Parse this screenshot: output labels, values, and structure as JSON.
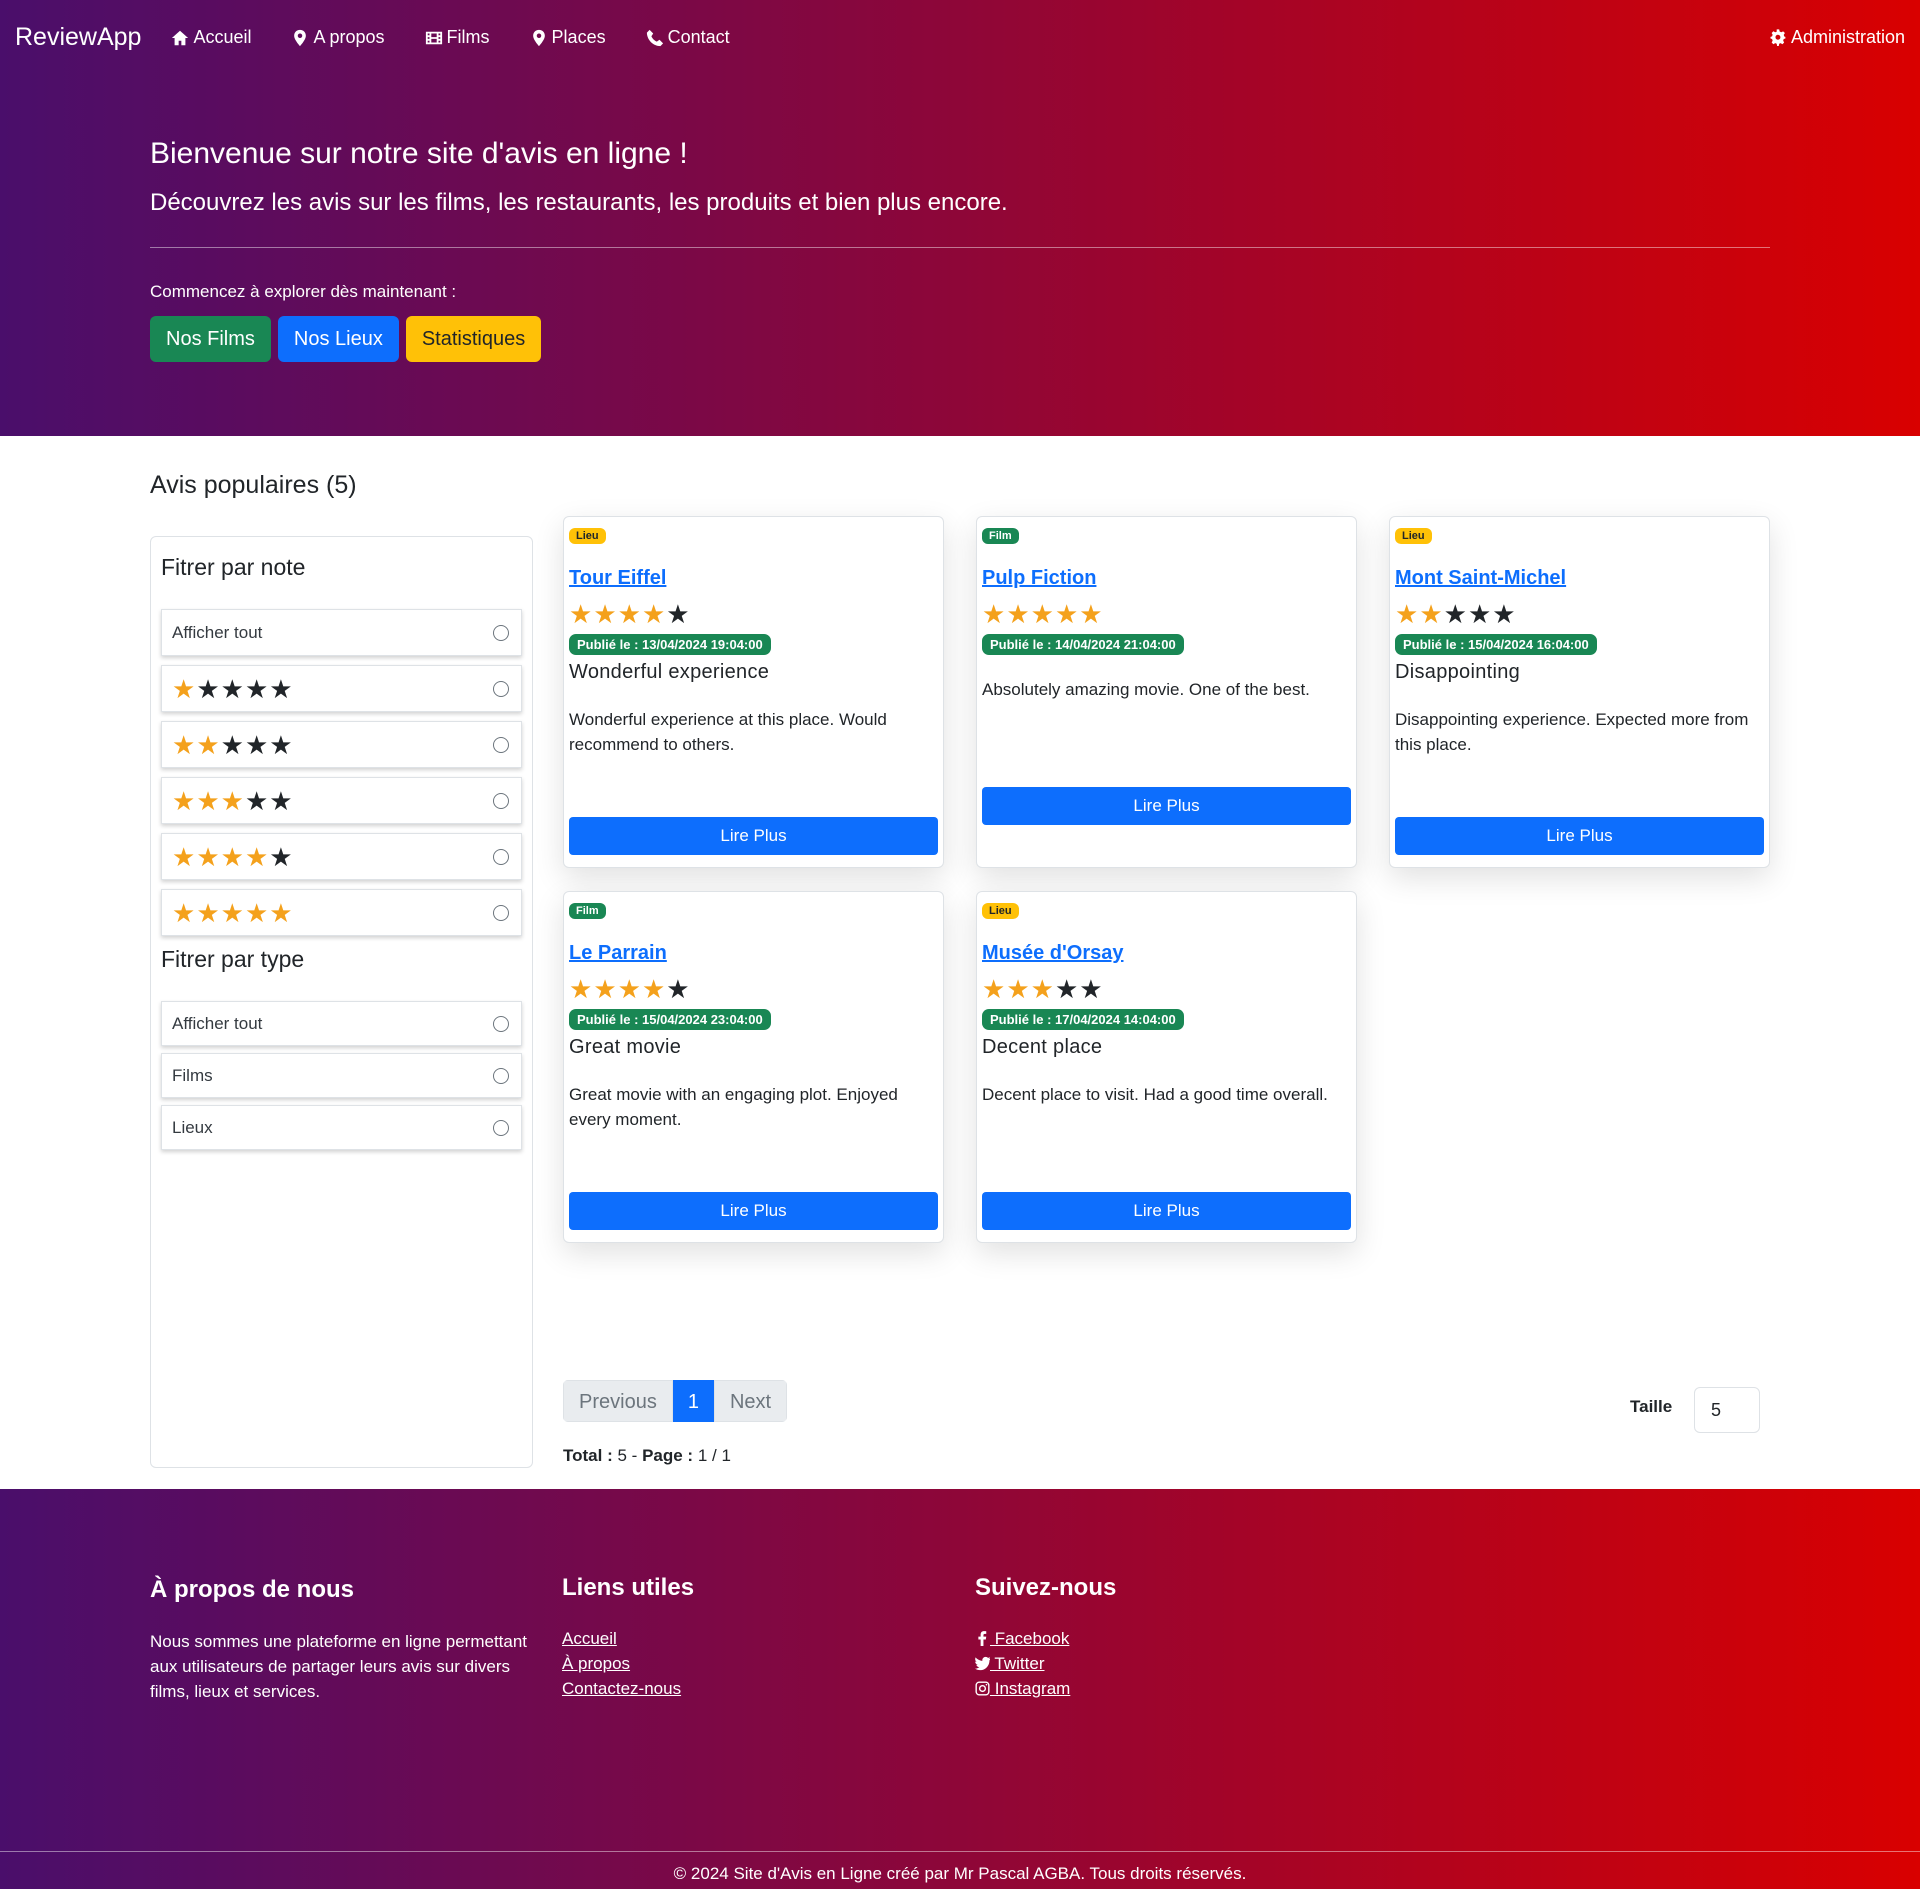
{
  "nav": {
    "brand": "ReviewApp",
    "items": [
      {
        "label": "Accueil",
        "icon": "home-icon"
      },
      {
        "label": "A propos",
        "icon": "map-marker-icon"
      },
      {
        "label": "Films",
        "icon": "film-icon"
      },
      {
        "label": "Places",
        "icon": "map-marker-icon"
      },
      {
        "label": "Contact",
        "icon": "phone-icon"
      }
    ],
    "admin": "Administration"
  },
  "hero": {
    "title": "Bienvenue sur notre site d'avis en ligne !",
    "lead": "Découvrez les avis sur les films, les restaurants, les produits et bien plus encore.",
    "cta": "Commencez à explorer dès maintenant :",
    "buttons": {
      "films": "Nos Films",
      "lieux": "Nos Lieux",
      "stats": "Statistiques"
    }
  },
  "reviews": {
    "heading": "Avis populaires (5)",
    "filters": {
      "note_title": "Fitrer par note",
      "show_all": "Afficher tout",
      "note_options": [
        1,
        2,
        3,
        4,
        5
      ],
      "type_title": "Fitrer par type",
      "type_show_all": "Afficher tout",
      "type_films": "Films",
      "type_lieux": "Lieux"
    },
    "pagination": {
      "previous": "Previous",
      "current": "1",
      "next": "Next",
      "total_label": "Total :",
      "total_value": "5",
      "separator": "-",
      "page_label": "Page :",
      "page_value": "1 / 1",
      "taille_label": "Taille",
      "taille_value": "5"
    },
    "read_more": "Lire Plus",
    "cards": [
      {
        "type": "Lieu",
        "title": "Tour Eiffel",
        "rating": 4,
        "date": "Publié le : 13/04/2024 19:04:00",
        "subtitle": "Wonderful experience",
        "text": "Wonderful experience at this place. Would recommend to others."
      },
      {
        "type": "Film",
        "title": "Pulp Fiction",
        "rating": 5,
        "date": "Publié le : 14/04/2024 21:04:00",
        "subtitle": "",
        "text": "Absolutely amazing movie. One of the best."
      },
      {
        "type": "Lieu",
        "title": "Mont Saint-Michel",
        "rating": 2,
        "date": "Publié le : 15/04/2024 16:04:00",
        "subtitle": "Disappointing",
        "text": "Disappointing experience. Expected more from this place."
      },
      {
        "type": "Film",
        "title": "Le Parrain",
        "rating": 4,
        "date": "Publié le : 15/04/2024 23:04:00",
        "subtitle": "Great movie",
        "text": "Great movie with an engaging plot. Enjoyed every moment."
      },
      {
        "type": "Lieu",
        "title": "Musée d'Orsay",
        "rating": 3,
        "date": "Publié le : 17/04/2024 14:04:00",
        "subtitle": "Decent place",
        "text": "Decent place to visit. Had a good time overall."
      }
    ]
  },
  "footer": {
    "about_title": "À propos de nous",
    "about_text": "Nous sommes une plateforme en ligne permettant aux utilisateurs de partager leurs avis sur divers films, lieux et services.",
    "links_title": "Liens utiles",
    "links": [
      "Accueil",
      "À propos",
      "Contactez-nous"
    ],
    "social_title": "Suivez-nous",
    "social": [
      {
        "label": " Facebook",
        "icon": "facebook-icon"
      },
      {
        "label": " Twitter",
        "icon": "twitter-icon"
      },
      {
        "label": " Instagram",
        "icon": "instagram-icon"
      }
    ],
    "copyright": "© 2024 Site d'Avis en Ligne créé par Mr Pascal AGBA. Tous droits réservés."
  },
  "colors": {
    "star": "#f4a11c",
    "primary": "#0d6efd",
    "success": "#198754",
    "warning": "#ffc107",
    "gradient_start": "#4a0e6b",
    "gradient_end": "#d90000"
  }
}
